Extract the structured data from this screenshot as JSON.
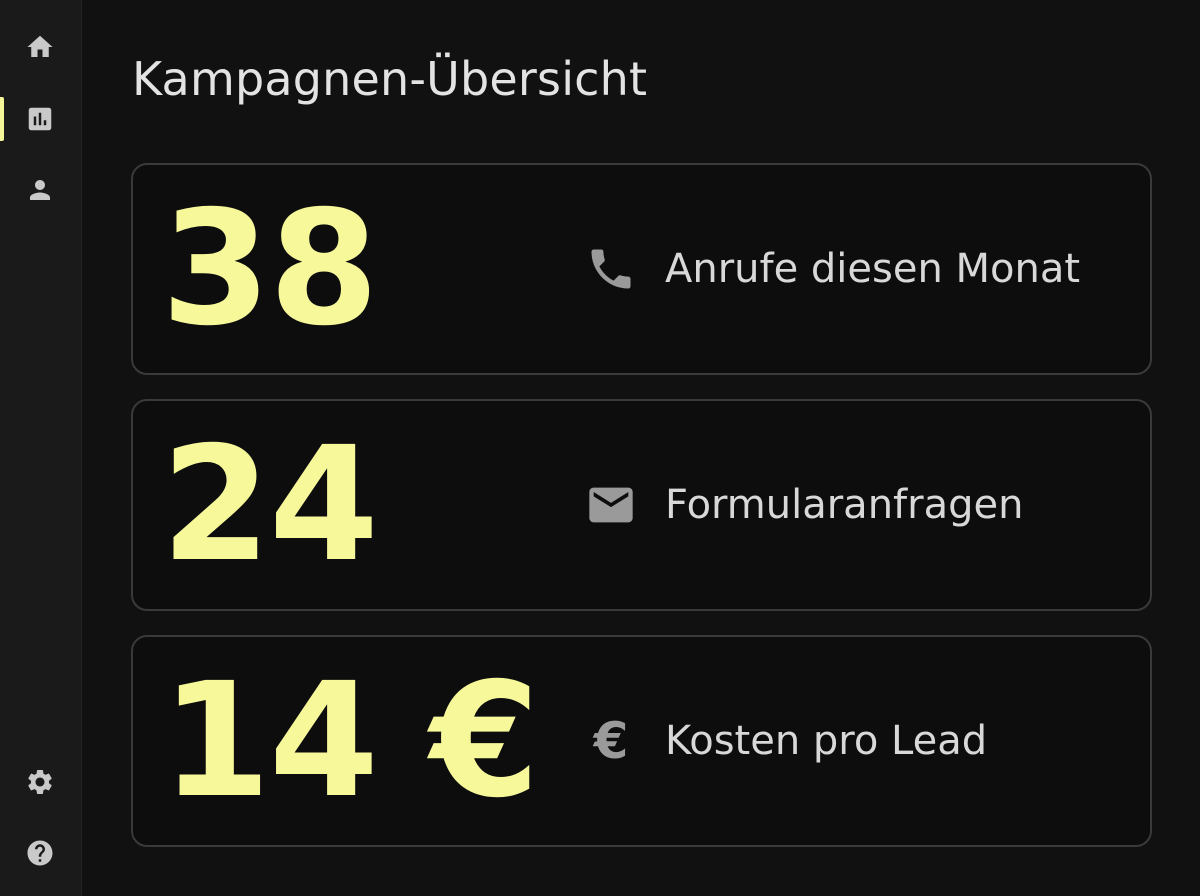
{
  "page": {
    "title": "Kampagnen-Übersicht"
  },
  "sidebar": {
    "items": [
      {
        "icon": "home-icon"
      },
      {
        "icon": "bar-chart-icon",
        "active": true
      },
      {
        "icon": "user-icon"
      },
      {
        "icon": "gear-icon"
      },
      {
        "icon": "help-icon"
      }
    ]
  },
  "metrics": [
    {
      "value": "38",
      "icon": "phone-icon",
      "label": "Anrufe diesen Monat"
    },
    {
      "value": "24",
      "icon": "mail-icon",
      "label": "Formularanfragen"
    },
    {
      "value": "14 €",
      "icon": "euro-icon",
      "icon_glyph": "€",
      "label": "Kosten pro Lead"
    }
  ],
  "colors": {
    "background": "#111111",
    "sidebar": "#1a1a1a",
    "accent": "#f6f89a",
    "card_border": "#3a3a3a",
    "label_text": "#d8d8d8",
    "icon": "#9a9a9a"
  }
}
